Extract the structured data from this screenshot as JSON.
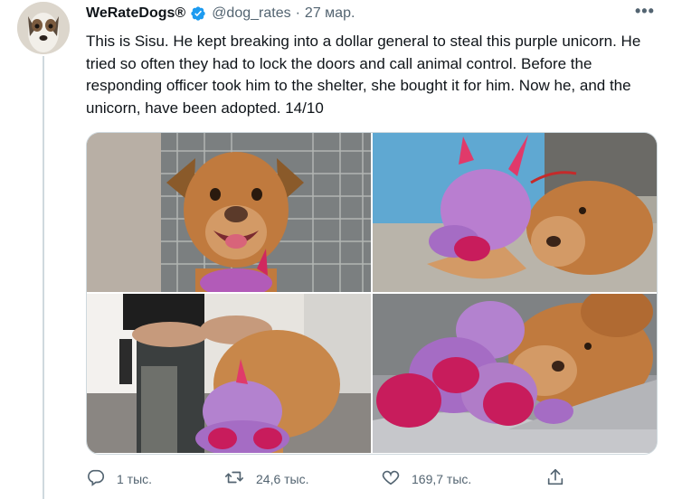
{
  "tweet": {
    "author_name": "WeRateDogs®",
    "handle": "@dog_rates",
    "separator": "·",
    "date": "27 мар.",
    "text": "This is Sisu. He kept breaking into a dollar general to steal this purple unicorn. He tried so often they had to lock the doors and call animal control. Before the responding officer took him to the shelter, she bought it for him. Now he, and the unicorn, have been adopted. 14/10",
    "more_glyph": "•••"
  },
  "actions": {
    "reply_count": "1 тыс.",
    "retweet_count": "24,6 тыс.",
    "like_count": "169,7 тыс."
  },
  "colors": {
    "verified": "#1d9bf0",
    "secondary_text": "#536471",
    "thread_line": "#cfd9de"
  },
  "icons": [
    "verified-badge-icon",
    "more-icon",
    "reply-icon",
    "retweet-icon",
    "like-icon",
    "share-icon"
  ]
}
